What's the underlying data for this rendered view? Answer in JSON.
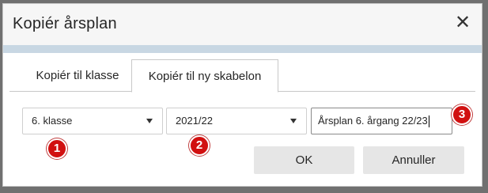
{
  "dialog": {
    "title": "Kopiér årsplan",
    "close_icon": "close-icon"
  },
  "tabs": [
    {
      "label": "Kopiér til klasse",
      "active": false
    },
    {
      "label": "Kopiér til ny skabelon",
      "active": true
    }
  ],
  "form": {
    "class_select": {
      "value": "6. klasse",
      "icon": "caret-down-icon"
    },
    "year_select": {
      "value": "2021/22",
      "icon": "caret-down-icon"
    },
    "name_input": {
      "value": "Årsplan 6. årgang 22/23"
    }
  },
  "markers": [
    "1",
    "2",
    "3"
  ],
  "buttons": {
    "ok_label": "OK",
    "cancel_label": "Annuller"
  },
  "colors": {
    "accent_bar": "#c8d7e3",
    "marker_red": "#d11010",
    "button_bg": "#e6e6e6",
    "backdrop": "#707070"
  }
}
